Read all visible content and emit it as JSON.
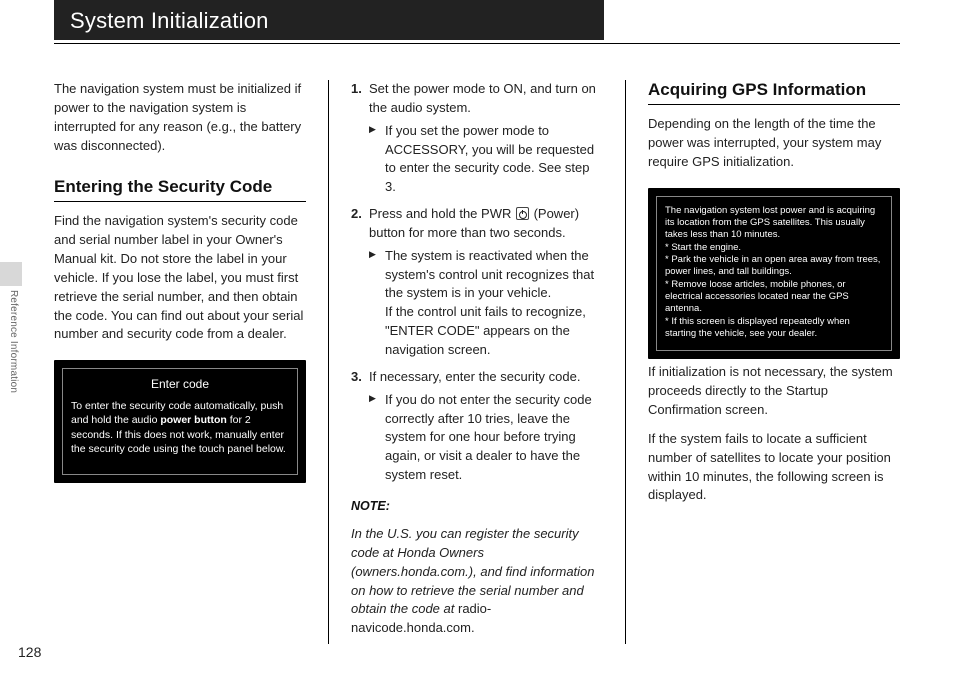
{
  "page_title": "System Initialization",
  "side_label": "Reference Information",
  "page_number": "128",
  "col1": {
    "intro": "The navigation system must be initialized if power to the navigation system is interrupted for any reason (e.g., the battery was disconnected).",
    "h_security": "Entering the Security Code",
    "security_p": "Find the navigation system's security code and serial number label in your Owner's Manual kit. Do not store the label in your vehicle. If you lose the label, you must first retrieve the serial number, and then obtain the code. You can find out about your serial number and security code from a dealer.",
    "screen_title": "Enter code",
    "screen_body_prefix": "To enter the security code automatically, push and hold the audio ",
    "screen_body_bold": "power button",
    "screen_body_suffix": " for 2 seconds. If this does not work, manually enter the security code using the touch panel below."
  },
  "col2": {
    "step1": "Set the power mode to ON, and turn on the audio system.",
    "step1_sub": "If you set the power mode to ACCESSORY, you will be requested to enter the security code. See step 3.",
    "step2_a": "Press and hold the PWR ",
    "step2_b": " (Power) button for more than two seconds.",
    "step2_sub1": "The system is reactivated when the system's control unit recognizes that the system is in your vehicle.",
    "step2_sub2": "If the control unit fails to recognize, \"ENTER CODE\" appears on the navigation screen.",
    "step3": "If necessary, enter the security code.",
    "step3_sub": "If you do not enter the security code correctly after 10 tries, leave the system for one hour before trying again, or visit a dealer to have the system reset.",
    "note_label": "NOTE:",
    "note_body_italic": "In the U.S. you can register the security code at Honda Owners (owners.honda.com.), and find information on how to retrieve the serial number and obtain the code at ",
    "note_body_plain": "radio-navicode.honda.com."
  },
  "col3": {
    "h_gps": "Acquiring GPS Information",
    "gps_p1": "Depending on the length of the time the power was interrupted, your system may require GPS initialization.",
    "screen2_l1": "The navigation system lost power and is acquiring its location from the GPS satellites. This usually takes less than 10 minutes.",
    "screen2_l2": "* Start the engine.",
    "screen2_l3": "* Park the vehicle in an open area away from trees, power lines, and tall buildings.",
    "screen2_l4": "* Remove loose articles, mobile phones, or electrical accessories located near the GPS antenna.",
    "screen2_l5": "* If this screen is displayed repeatedly when starting the vehicle, see your dealer.",
    "gps_p2": "If initialization is not necessary, the system proceeds directly to the Startup Confirmation screen.",
    "gps_p3": "If the system fails to locate a sufficient number of satellites to locate your position within 10 minutes, the following screen is displayed."
  }
}
